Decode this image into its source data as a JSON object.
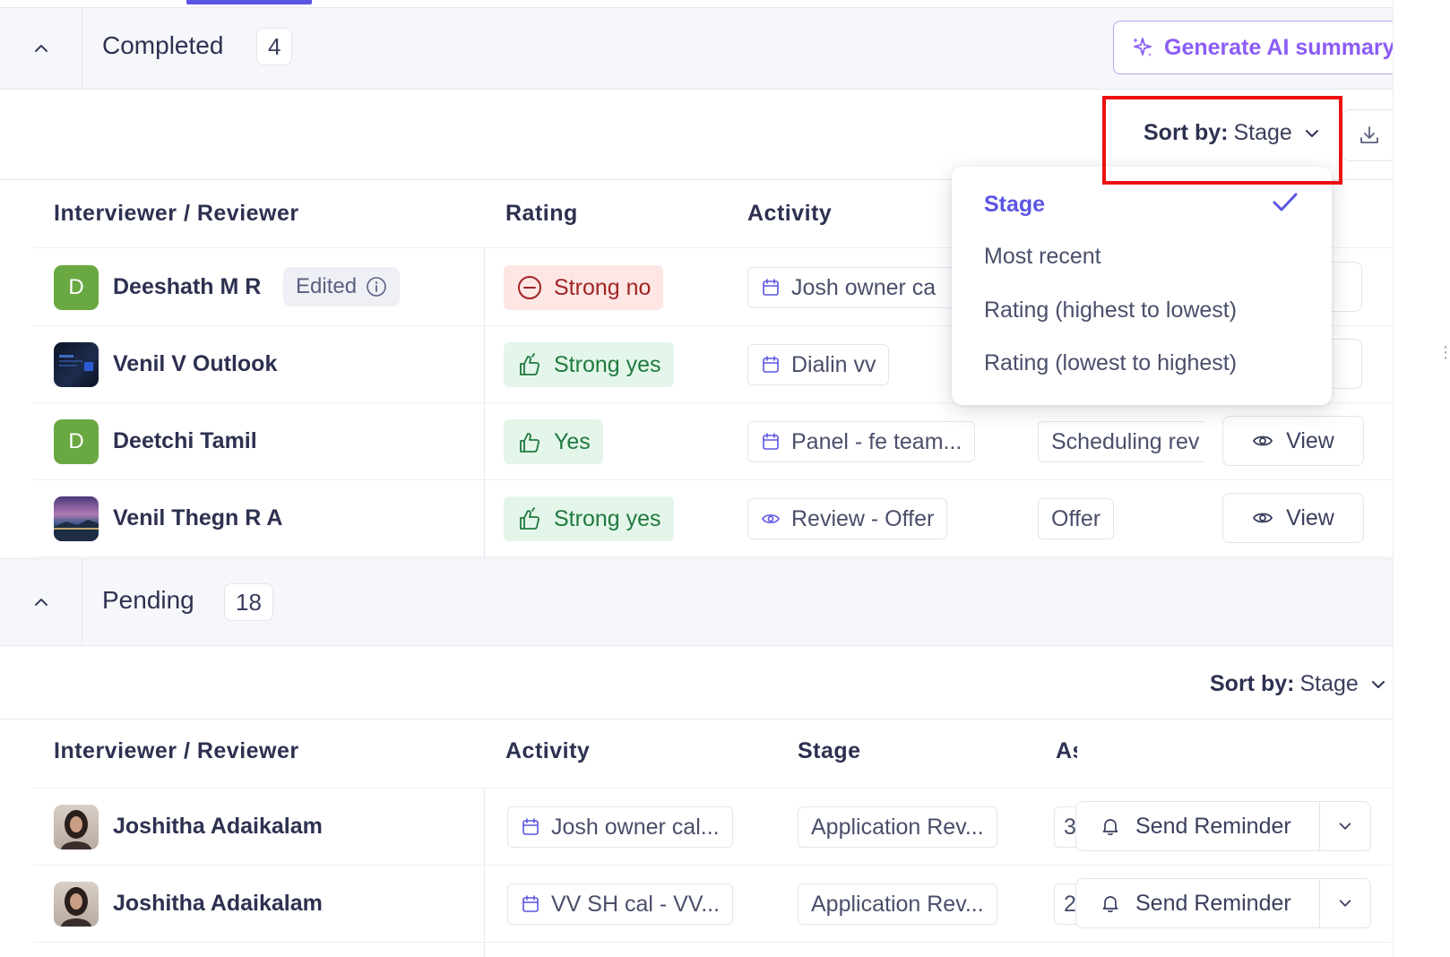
{
  "completed": {
    "title": "Completed",
    "count": "4",
    "ai_button": "Generate AI summary",
    "sort": {
      "label": "Sort by:",
      "value": "Stage"
    },
    "columns": [
      "Interviewer / Reviewer",
      "Rating",
      "Activity"
    ],
    "rows": [
      {
        "avatar": "D",
        "name": "Deeshath M R",
        "edited": "Edited",
        "rating": "Strong no",
        "activity": "Josh owner ca"
      },
      {
        "avatar": "",
        "name": "Venil V Outlook",
        "rating": "Strong yes",
        "activity": "Dialin vv"
      },
      {
        "avatar": "D",
        "name": "Deetchi Tamil",
        "rating": "Yes",
        "activity": "Panel - fe team...",
        "stage": "Scheduling rev",
        "action": "View"
      },
      {
        "avatar": "",
        "name": "Venil Thegn R A",
        "rating": "Strong yes",
        "activity": "Review - Offer",
        "stage": "Offer",
        "action": "View"
      }
    ]
  },
  "dropdown": {
    "items": [
      "Stage",
      "Most recent",
      "Rating (highest to lowest)",
      "Rating (lowest to highest)"
    ],
    "selected": "Stage"
  },
  "pending": {
    "title": "Pending",
    "count": "18",
    "sort": {
      "label": "Sort by:",
      "value": "Stage"
    },
    "columns": [
      "Interviewer / Reviewer",
      "Activity",
      "Stage",
      "As"
    ],
    "rows": [
      {
        "name": "Joshitha Adaikalam",
        "activity": "Josh owner cal...",
        "stage": "Application Rev...",
        "assigned": "3",
        "action": "Send Reminder"
      },
      {
        "name": "Joshitha Adaikalam",
        "activity": "VV SH cal - VV...",
        "stage": "Application Rev...",
        "assigned": "2",
        "action": "Send Reminder"
      }
    ]
  },
  "colors": {
    "accent": "#5b55e3",
    "ai": "#8b5cf6",
    "negative": "#a12424",
    "positive": "#1f7a3e",
    "highlight": "#ee1111"
  }
}
